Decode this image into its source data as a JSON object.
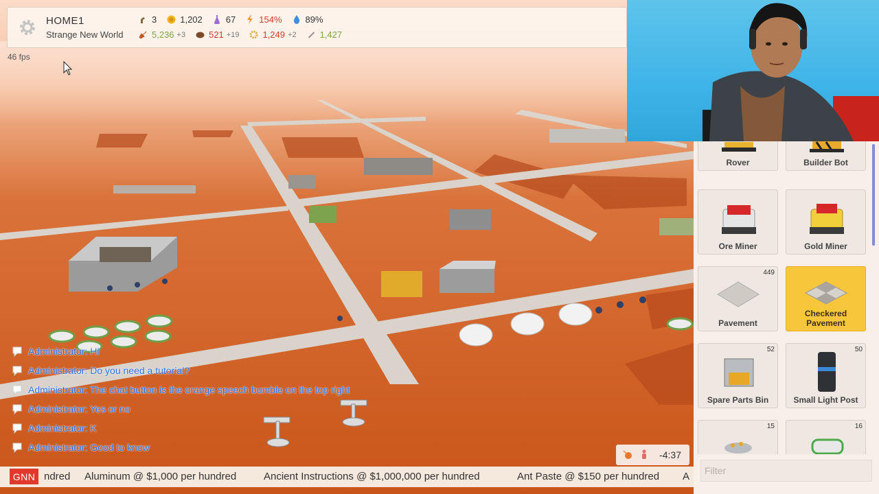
{
  "hud": {
    "base_name": "HOME1",
    "planet_name": "Strange New World",
    "fps": "46 fps",
    "row1": [
      {
        "icon": "colonist-icon",
        "value": "3"
      },
      {
        "icon": "coin-icon",
        "value": "1,202"
      },
      {
        "icon": "research-flask-icon",
        "value": "67"
      },
      {
        "icon": "power-bolt-icon",
        "value": "154%"
      },
      {
        "icon": "water-drop-icon",
        "value": "89%"
      }
    ],
    "row2": [
      {
        "icon": "shovel-icon",
        "value": "5,236",
        "delta": "+3"
      },
      {
        "icon": "ore-icon",
        "value": "521",
        "delta": "+19"
      },
      {
        "icon": "gear-part-icon",
        "value": "1,249",
        "delta": "+2"
      },
      {
        "icon": "stone-icon",
        "value": "1,427",
        "delta": ""
      }
    ]
  },
  "build_panel": {
    "items": [
      {
        "label": "Rover",
        "count": "",
        "selected": false,
        "icon": "rover-icon"
      },
      {
        "label": "Builder Bot",
        "count": "",
        "selected": false,
        "icon": "builder-bot-icon"
      },
      {
        "label": "Ore Miner",
        "count": "",
        "selected": false,
        "icon": "ore-miner-icon"
      },
      {
        "label": "Gold Miner",
        "count": "",
        "selected": false,
        "icon": "gold-miner-icon"
      },
      {
        "label": "Pavement",
        "count": "449",
        "selected": false,
        "icon": "pavement-icon"
      },
      {
        "label": "Checkered Pavement",
        "count": "",
        "selected": true,
        "icon": "checkered-pavement-icon"
      },
      {
        "label": "Spare Parts Bin",
        "count": "52",
        "selected": false,
        "icon": "spare-parts-bin-icon"
      },
      {
        "label": "Small Light Post",
        "count": "50",
        "selected": false,
        "icon": "light-post-icon"
      },
      {
        "label": "",
        "count": "15",
        "selected": false,
        "icon": "lamp-cluster-icon"
      },
      {
        "label": "",
        "count": "16",
        "selected": false,
        "icon": "pipe-bundle-icon"
      }
    ],
    "filter_placeholder": "Filter"
  },
  "chat": [
    "Administrator: Hi",
    "Administrator: Do you need a tutorial?",
    "Administrator: The chat button is the orange speech bumble on the top right",
    "Administrator: Yes or no",
    "Administrator: K",
    "Administrator: Good to know"
  ],
  "timer": {
    "time": "-4:37"
  },
  "ticker": {
    "badge": "GNN",
    "items": [
      "ndred",
      "Aluminum @ $1,000 per hundred",
      "Ancient Instructions @ $1,000,000 per hundred",
      "Ant Paste @ $150 per hundred",
      "A"
    ]
  },
  "colors": {
    "ground": "#cf5a1f",
    "road": "#d8d2cb",
    "chat_text": "#2c6fe0",
    "selected_item": "#f7c63a",
    "gnn_red": "#e23a2a"
  }
}
